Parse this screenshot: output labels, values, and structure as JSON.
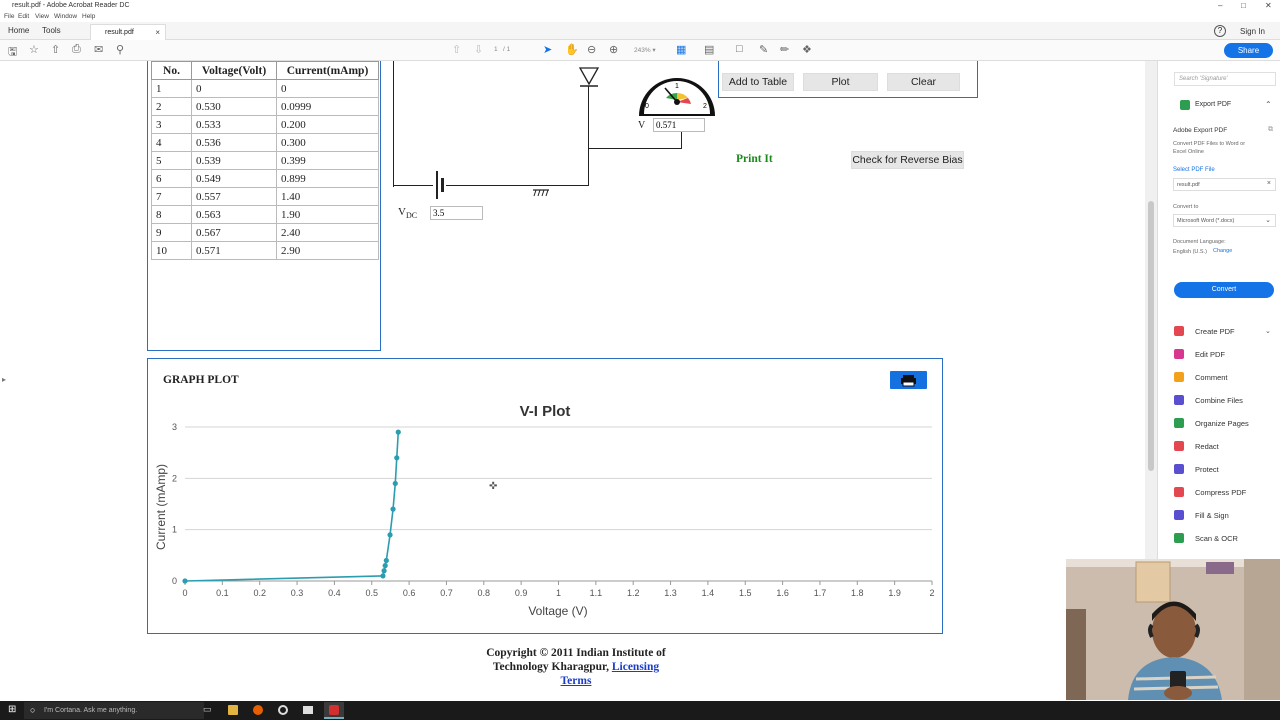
{
  "window": {
    "title": "result.pdf - Adobe Acrobat Reader DC"
  },
  "menu": [
    "File",
    "Edit",
    "View",
    "Window",
    "Help"
  ],
  "tabs": {
    "home": "Home",
    "tools": "Tools",
    "document": "result.pdf"
  },
  "account": {
    "sign_in": "Sign In",
    "help": "?"
  },
  "toolbar": {
    "page_current": "1",
    "page_total": "/ 1",
    "zoom": "243%",
    "share_label": "Share"
  },
  "observation_table": {
    "headers": [
      "No.",
      "Voltage(Volt)",
      "Current(mAmp)"
    ],
    "rows": [
      [
        "1",
        "0",
        "0"
      ],
      [
        "2",
        "0.530",
        "0.0999"
      ],
      [
        "3",
        "0.533",
        "0.200"
      ],
      [
        "4",
        "0.536",
        "0.300"
      ],
      [
        "5",
        "0.539",
        "0.399"
      ],
      [
        "6",
        "0.549",
        "0.899"
      ],
      [
        "7",
        "0.557",
        "1.40"
      ],
      [
        "8",
        "0.563",
        "1.90"
      ],
      [
        "9",
        "0.567",
        "2.40"
      ],
      [
        "10",
        "0.571",
        "2.90"
      ]
    ]
  },
  "circuit": {
    "vdc_label": "V",
    "vdc_sub": "DC",
    "vdc_value": "3.5",
    "voltmeter_label": "V",
    "voltmeter_value": "0.571",
    "meter_scale": {
      "min": "0",
      "mid": "1",
      "max": "2"
    }
  },
  "controls": {
    "add_to_table": "Add to Table",
    "plot": "Plot",
    "clear": "Clear",
    "print_it": "Print It",
    "reverse_bias": "Check for Reverse Bias"
  },
  "graph": {
    "panel_title": "GRAPH PLOT"
  },
  "chart_data": {
    "type": "line",
    "title": "V-I Plot",
    "xlabel": "Voltage (V)",
    "ylabel": "Current (mAmp)",
    "xlim": [
      0,
      2
    ],
    "ylim": [
      0,
      3
    ],
    "x_ticks": [
      "0",
      "0.1",
      "0.2",
      "0.3",
      "0.4",
      "0.5",
      "0.6",
      "0.7",
      "0.8",
      "0.9",
      "1",
      "1.1",
      "1.2",
      "1.3",
      "1.4",
      "1.5",
      "1.6",
      "1.7",
      "1.8",
      "1.9",
      "2"
    ],
    "y_ticks": [
      "0",
      "1",
      "2",
      "3"
    ],
    "grid": true,
    "color": "#2a9db0",
    "series": [
      {
        "x": [
          0,
          0.53,
          0.533,
          0.536,
          0.539,
          0.549,
          0.557,
          0.563,
          0.567,
          0.571
        ],
        "y": [
          0,
          0.0999,
          0.2,
          0.3,
          0.399,
          0.899,
          1.4,
          1.9,
          2.4,
          2.9
        ]
      }
    ]
  },
  "footer": {
    "copyright_line1": "Copyright © 2011 Indian Institute of",
    "copyright_line2": "Technology Kharagpur,",
    "link1": "Licensing",
    "link2": "Terms"
  },
  "right_panel": {
    "search_placeholder": "Search 'Signature'",
    "export_header": "Export PDF",
    "export_title": "Adobe Export PDF",
    "export_desc": "Convert PDF Files to Word or Excel Online",
    "select_pdf": "Select PDF File",
    "file_name": "result.pdf",
    "convert_to": "Convert to",
    "format": "Microsoft Word (*.docx)",
    "doc_language": "Document Language:",
    "language": "English (U.S.)",
    "change": "Change",
    "convert_button": "Convert",
    "tools": [
      {
        "label": "Create PDF",
        "color": "#e34850"
      },
      {
        "label": "Edit PDF",
        "color": "#d83790"
      },
      {
        "label": "Comment",
        "color": "#f2a11d"
      },
      {
        "label": "Combine Files",
        "color": "#5a4fcf"
      },
      {
        "label": "Organize Pages",
        "color": "#2d9d4f"
      },
      {
        "label": "Redact",
        "color": "#e34850"
      },
      {
        "label": "Protect",
        "color": "#5a4fcf"
      },
      {
        "label": "Compress PDF",
        "color": "#e34850"
      },
      {
        "label": "Fill & Sign",
        "color": "#5a4fcf"
      },
      {
        "label": "Scan & OCR",
        "color": "#2d9d4f"
      }
    ]
  },
  "taskbar": {
    "search_placeholder": "I'm Cortana. Ask me anything."
  }
}
